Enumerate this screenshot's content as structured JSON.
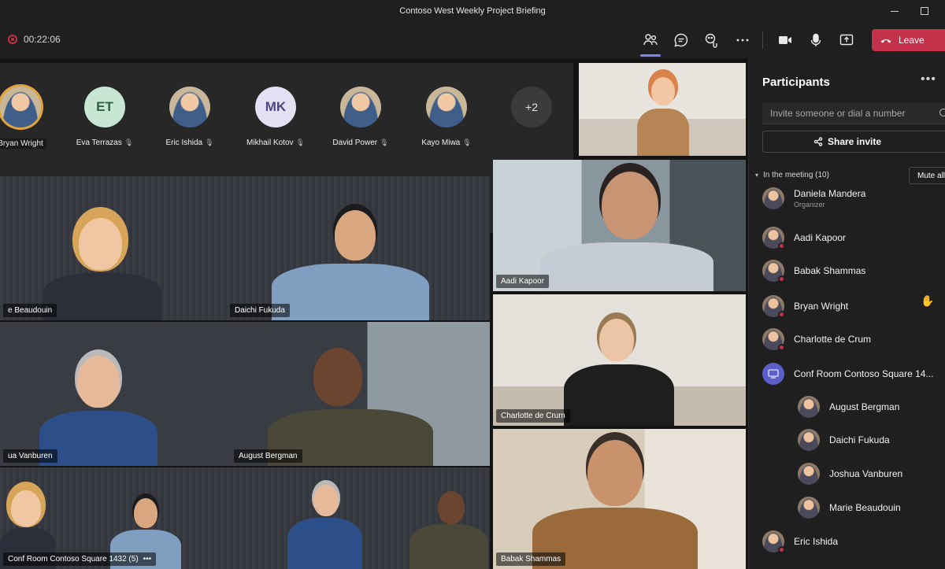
{
  "window": {
    "title": "Contoso West Weekly Project Briefing"
  },
  "toolbar": {
    "timer": "00:22:06",
    "icons": [
      "people-icon",
      "chat-icon",
      "reactions-icon",
      "more-icon",
      "camera-icon",
      "mic-icon",
      "share-icon"
    ],
    "leave_label": "Leave"
  },
  "roster": {
    "people": [
      {
        "name": "Bryan Wright",
        "initials": "",
        "photo": true,
        "speaking": true,
        "muted": false
      },
      {
        "name": "Eva Terrazas",
        "initials": "ET",
        "photo": false,
        "color": "#c8e6d4",
        "text_color": "#2f5f47",
        "muted": true
      },
      {
        "name": "Eric Ishida",
        "initials": "",
        "photo": true,
        "muted": true
      },
      {
        "name": "Mikhail Kotov",
        "initials": "MK",
        "photo": false,
        "color": "#e6e0f4",
        "text_color": "#4f4680",
        "muted": true
      },
      {
        "name": "David Power",
        "initials": "",
        "photo": true,
        "muted": true
      },
      {
        "name": "Kayo Miwa",
        "initials": "",
        "photo": true,
        "muted": true
      }
    ],
    "overflow": "+2"
  },
  "stage": {
    "tiles": [
      {
        "label": "e Beaudouin"
      },
      {
        "label": "Daichi Fukuda"
      },
      {
        "label": "ua Vanburen"
      },
      {
        "label": "August Bergman"
      },
      {
        "label": "Conf Room Contoso Square 1432 (5)",
        "more": "•••"
      },
      {
        "label": "Aadi Kapoor"
      },
      {
        "label": "Charlotte de Crum"
      },
      {
        "label": "Babak Shammas"
      }
    ]
  },
  "panel": {
    "title": "Participants",
    "more": "•••",
    "invite_placeholder": "Invite someone or dial a number",
    "share_label": "Share invite",
    "section_label": "In the meeting (10)",
    "mute_all_label": "Mute all",
    "participants": [
      {
        "name": "Daniela Mandera",
        "role": "Organizer"
      },
      {
        "name": "Aadi Kapoor"
      },
      {
        "name": "Babak Shammas"
      },
      {
        "name": "Bryan Wright",
        "hand_raised": true
      },
      {
        "name": "Charlotte de Crum"
      },
      {
        "name": "Conf Room Contoso Square 14..."
      },
      {
        "name": "August Bergman"
      },
      {
        "name": "Daichi Fukuda"
      },
      {
        "name": "Joshua Vanburen"
      },
      {
        "name": "Marie Beaudouin"
      },
      {
        "name": "Eric Ishida"
      }
    ]
  },
  "colors": {
    "accent": "#7f85f5",
    "leave": "#c4314b",
    "background": "#1f1f1f"
  }
}
